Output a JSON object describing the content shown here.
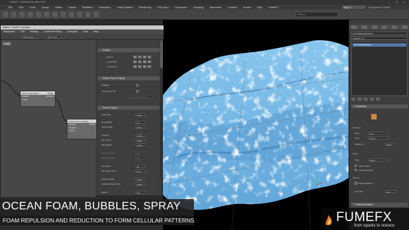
{
  "window": {
    "title": "Untitled - Autodesk 3ds Max 2019",
    "menu": [
      "File",
      "Edit",
      "Tools",
      "Group",
      "Views",
      "Create",
      "Modifiers",
      "Animation",
      "Graph Editors",
      "Rendering",
      "Civil View",
      "Customize",
      "Scripting",
      "Interactive",
      "Content",
      "Arnold",
      "Help",
      "FumeFX"
    ],
    "sign_in": "Sign In",
    "workspace_label": "Workspaces: Default",
    "search_placeholder": "Search..."
  },
  "slate": {
    "title": "Slate4 - FumeFX Operator",
    "menu": [
      "Workspace",
      "Edit",
      "Settings",
      "Customize Editor",
      "Computer",
      "View",
      "Help"
    ],
    "toolbar": {
      "workspace": "Workspace 1",
      "mode": "Slate View"
    },
    "graph_tag": "scalar",
    "nodes": {
      "source": {
        "title": "Ocean Spec/Veloc",
        "head_right": "Bridge",
        "ports": [
          "Enabled",
          "Ocean"
        ],
        "port_right": "Simulate"
      },
      "spray": {
        "title": "Ocean Foam & Spray",
        "head_right": "Bridge",
        "ports": [
          "Enabled",
          "Simulate",
          "Output"
        ]
      }
    },
    "panel": {
      "groups_rollout": "Groups",
      "groups": [
        "Group 1",
        "_oceanscoll",
        "_oceanfoam"
      ],
      "foam_rollout": "Ocean Foam & Spray",
      "enabled_label": "Enabled",
      "use_ocean_label": "Use Ocean TM",
      "choose_ocean": "Choose Ocean Object",
      "section_rollout": "Foam & Spray",
      "rows": [
        {
          "label": "Emit Type",
          "value": "Foam"
        },
        {
          "label": "Emit Width",
          "value": "0.1"
        },
        {
          "label": "Emit Length",
          "value": "100.0"
        },
        {
          "label": "Amount",
          "value": "0.100"
        },
        {
          "label": "Min Curve",
          "value": "0.500"
        },
        {
          "label": "Min Height",
          "value": "0.000"
        },
        {
          "label": "Radius Curve",
          "value": "0.0"
        },
        {
          "label": "Radius Height",
          "value": "0.0"
        },
        {
          "label": "Life Span",
          "value": "25"
        },
        {
          "label": "Life Span Var %",
          "value": "10.0"
        },
        {
          "label": "Particle Scale",
          "value": "1.000"
        },
        {
          "label": "Particle Scale Var %",
          "value": "0.000"
        },
        {
          "label": "Speed",
          "value": "0.0"
        }
      ]
    }
  },
  "command_panel": {
    "object_name": "FFX WaterParticles01",
    "modifier_list": "Modifier List",
    "stack_item": "FFX WaterParticles",
    "parameters_rollout": "Parameters",
    "particles_label": "Particles",
    "rows": [
      {
        "label": "Type",
        "value": "Dot"
      },
      {
        "label": "Color",
        "value": "Group"
      },
      {
        "label": "Display %",
        "value": "100.0"
      }
    ],
    "mesh_label": "Mesh",
    "mesh_type": {
      "label": "Type",
      "value": "Sheet"
    },
    "checkbox_items": [
      "Vertex Color",
      "Selected Frame"
    ],
    "splines_label": "Splines",
    "display_splines": "Display Splines",
    "line_size_label": "Line Size",
    "line_size": "10.0",
    "bottom_rollout": "Particle Interfaces"
  },
  "overlay": {
    "heading": "OCEAN FOAM, BUBBLES, SPRAY",
    "subheading": "FOAM REPULSION AND REDUCTION TO FORM CELLULAR PATTERNS"
  },
  "logo": {
    "brand": "FUMEFX",
    "tagline": "from sparks to oceans"
  },
  "colors": {
    "accent": "#5278a8",
    "ocean": "#7fbde8",
    "ocean_dark": "#3e80b4",
    "foam": "#e6f4ff",
    "viewport_bg": "#000000",
    "ui_dark": "#3b3b3b"
  },
  "icons": [
    "fumefx-logo-icon",
    "fumefx-object-icon",
    "close-icon",
    "minimize-icon",
    "maximize-icon"
  ]
}
